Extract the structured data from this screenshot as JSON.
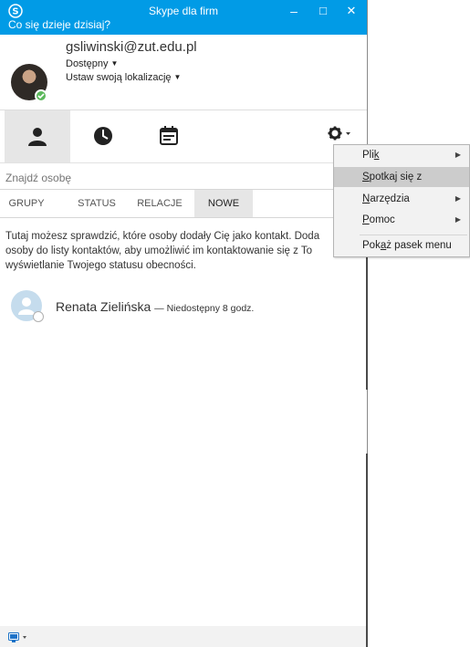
{
  "window": {
    "title": "Skype dla firm",
    "minimize_label": "–",
    "maximize_label": "□",
    "close_label": "✕"
  },
  "mood": {
    "placeholder": "Co się dzieje dzisiaj?"
  },
  "user": {
    "email": "gsliwinski@zut.edu.pl",
    "availability": "Dostępny",
    "location": "Ustaw swoją lokalizację",
    "status_color": "#5cb85c"
  },
  "main_tabs": [
    {
      "icon": "contacts-icon",
      "active": true
    },
    {
      "icon": "conversations-icon",
      "active": false
    },
    {
      "icon": "meetings-icon",
      "active": false
    }
  ],
  "search": {
    "placeholder": "Znajdź osobę"
  },
  "group_tabs": [
    {
      "label": "GRUPY"
    },
    {
      "label": "STATUS"
    },
    {
      "label": "RELACJE"
    },
    {
      "label": "NOWE",
      "active": true
    }
  ],
  "info_lines": [
    "Tutaj możesz sprawdzić, które osoby dodały Cię jako kontakt. Doda",
    "osoby do listy kontaktów, aby umożliwić im kontaktowanie się z To",
    "wyświetlanie Twojego statusu obecności."
  ],
  "contact": {
    "name": "Renata Zielińska",
    "status": "— Niedostępny 8 godz."
  },
  "menu": {
    "items": [
      {
        "pre": "Pli",
        "key": "k",
        "post": "",
        "submenu": true
      },
      {
        "pre": "",
        "key": "S",
        "post": "potkaj się z",
        "submenu": false,
        "highlighted": true
      },
      {
        "pre": "",
        "key": "N",
        "post": "arzędzia",
        "submenu": true
      },
      {
        "pre": "",
        "key": "P",
        "post": "omoc",
        "submenu": true
      },
      {
        "pre": "Pok",
        "key": "a",
        "post": "ż pasek menu",
        "submenu": false
      }
    ]
  },
  "colors": {
    "accent": "#019be6",
    "tab_active": "#e6e6e6",
    "menu_highlight": "#cccccc"
  }
}
